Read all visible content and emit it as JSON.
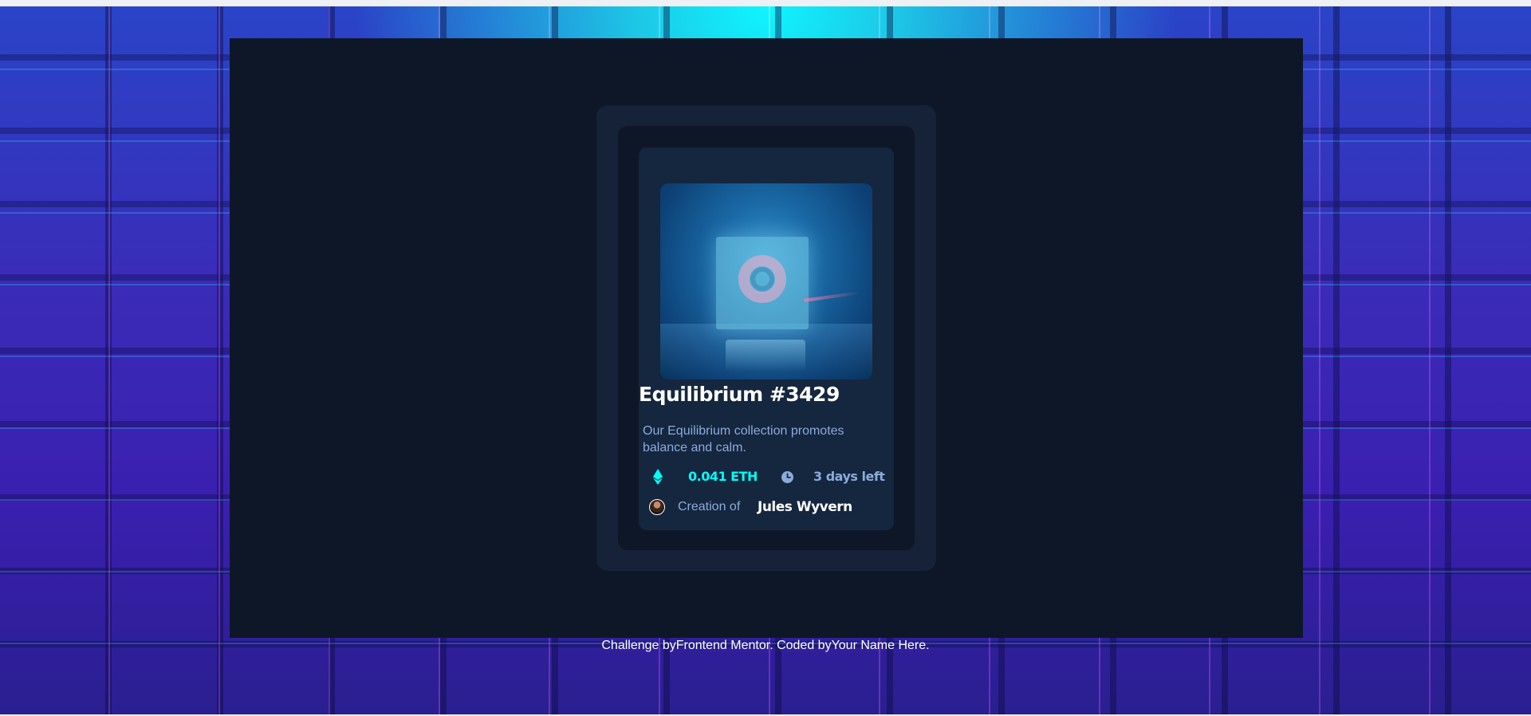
{
  "card": {
    "title": "Equilibrium #3429",
    "description": "Our Equilibrium collection promotes balance and calm.",
    "price": "0.041 ETH",
    "time_left": "3 days left",
    "creation_label": "Creation of",
    "creator_name": "Jules Wyvern",
    "image_icon": "equilibrium-cube-image",
    "eth_icon": "ethereum-icon",
    "clock_icon": "clock-icon"
  },
  "attribution": {
    "prefix": "Challenge by",
    "mentor_link": "Frontend Mentor",
    "middle": ". Coded by",
    "author_link": "Your Name Here",
    "suffix": "."
  },
  "colors": {
    "cyan": "#00fff8",
    "soft_blue": "#8bacd9",
    "panel": "#0e1728",
    "card": "#15263f"
  }
}
